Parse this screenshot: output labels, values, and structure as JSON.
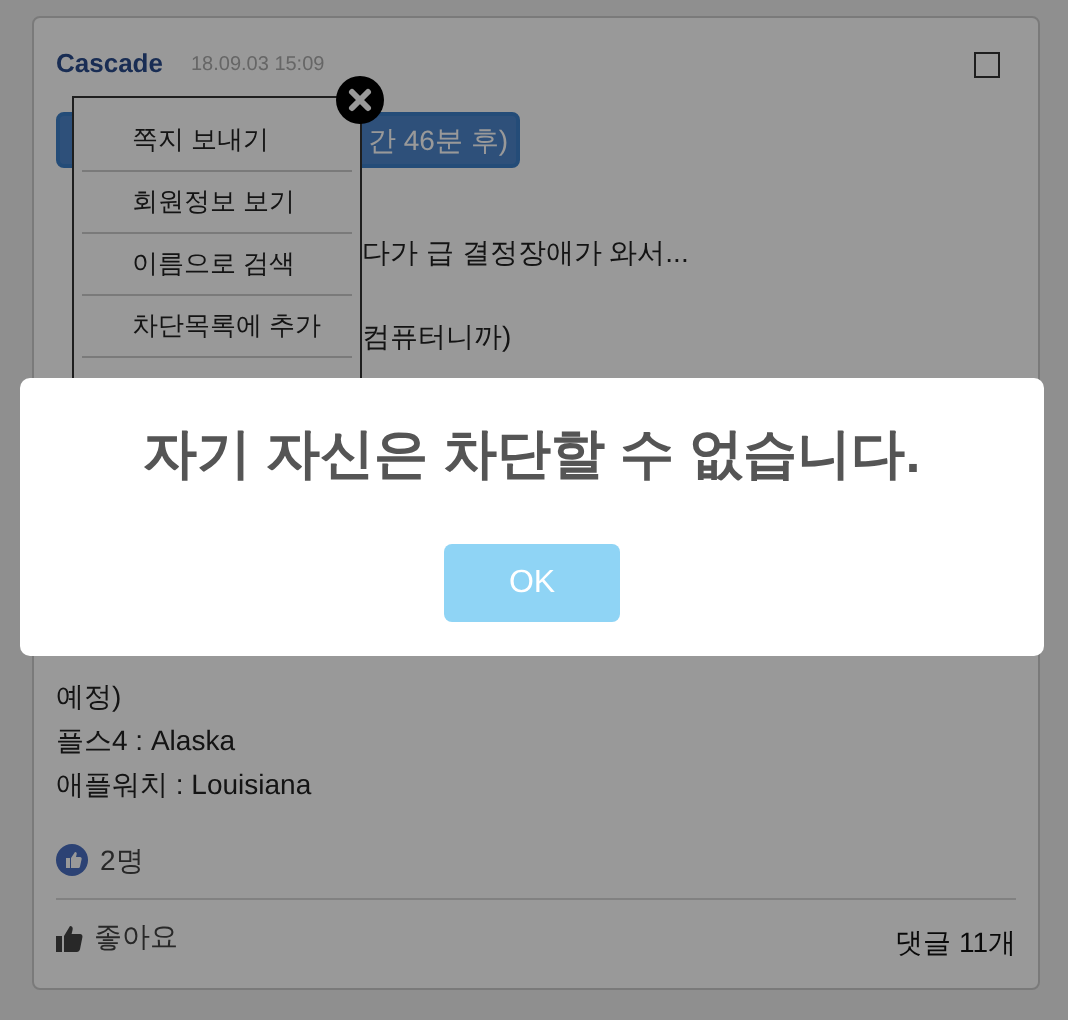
{
  "post": {
    "author": "Cascade",
    "date": "18.09.03 15:09",
    "select_box": {
      "checked": false
    },
    "tag_button": "간 46분 후)",
    "lines": [
      "다가 급 결정장애가 와서...",
      "컴퓨터니까)"
    ],
    "bottom_lines": [
      "예정)",
      "플스4 : Alaska",
      "애플워치 : Louisiana"
    ],
    "likes": "2명",
    "like_button": "좋아요",
    "comments": "댓글 11개"
  },
  "context_menu": {
    "items": [
      "쪽지 보내기",
      "회원정보 보기",
      "이름으로 검색",
      "차단목록에 추가"
    ]
  },
  "dialog": {
    "message": "자기 자신은 차단할 수 없습니다.",
    "ok": "OK"
  }
}
